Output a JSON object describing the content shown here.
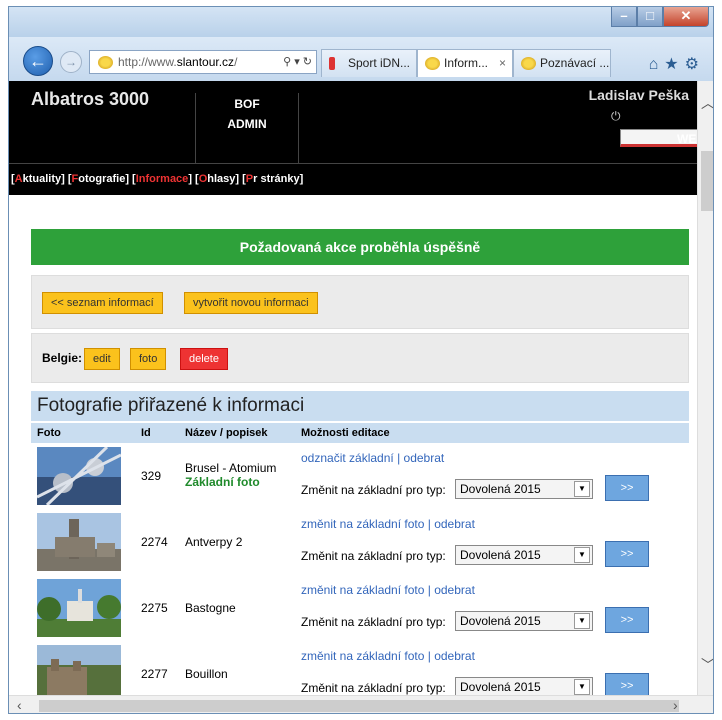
{
  "browser": {
    "url_prefix": "http://www.",
    "url_domain": "slantour.cz",
    "url_suffix": "/",
    "tabs": [
      "Sport iDN...",
      "Inform...",
      "Poznávací ..."
    ],
    "tab_close": "×"
  },
  "app": {
    "title": "Albatros 3000",
    "nav": [
      "BOF",
      "WEB",
      "ADMIN"
    ],
    "user": "Ladislav Peška",
    "submenu": [
      {
        "first": "A",
        "rest": "ktuality"
      },
      {
        "first": "F",
        "rest": "otografie"
      },
      {
        "first": "I",
        "rest": "nformace"
      },
      {
        "first": "O",
        "rest": "hlasy"
      },
      {
        "first": "P",
        "rest": "r stránky"
      }
    ],
    "success_message": "Požadovaná akce proběhla úspěšně",
    "btn_list": "<< seznam informací",
    "btn_new": "vytvořit novou informaci",
    "item_label": "Belgie:",
    "btn_edit": "edit",
    "btn_foto": "foto",
    "btn_delete": "delete",
    "section_title": "Fotografie přiřazené k informaci",
    "columns": [
      "Foto",
      "Id",
      "Název / popisek",
      "Možnosti editace"
    ]
  },
  "rows": [
    {
      "id": "329",
      "name": "Brusel - Atomium",
      "badge": "Základní foto",
      "action": "odznačit základní",
      "remove": "odebrat",
      "change_label": "Změnit na základní pro typ:",
      "select": "Dovolená 2015",
      "go": ">>"
    },
    {
      "id": "2274",
      "name": "Antverpy 2",
      "badge": "",
      "action": "změnit na základní foto",
      "remove": "odebrat",
      "change_label": "Změnit na základní pro typ:",
      "select": "Dovolená 2015",
      "go": ">>"
    },
    {
      "id": "2275",
      "name": "Bastogne",
      "badge": "",
      "action": "změnit na základní foto",
      "remove": "odebrat",
      "change_label": "Změnit na základní pro typ:",
      "select": "Dovolená 2015",
      "go": ">>"
    },
    {
      "id": "2277",
      "name": "Bouillon",
      "badge": "",
      "action": "změnit na základní foto",
      "remove": "odebrat",
      "change_label": "Změnit na základní pro typ:",
      "select": "Dovolená 2015",
      "go": ">>"
    }
  ]
}
